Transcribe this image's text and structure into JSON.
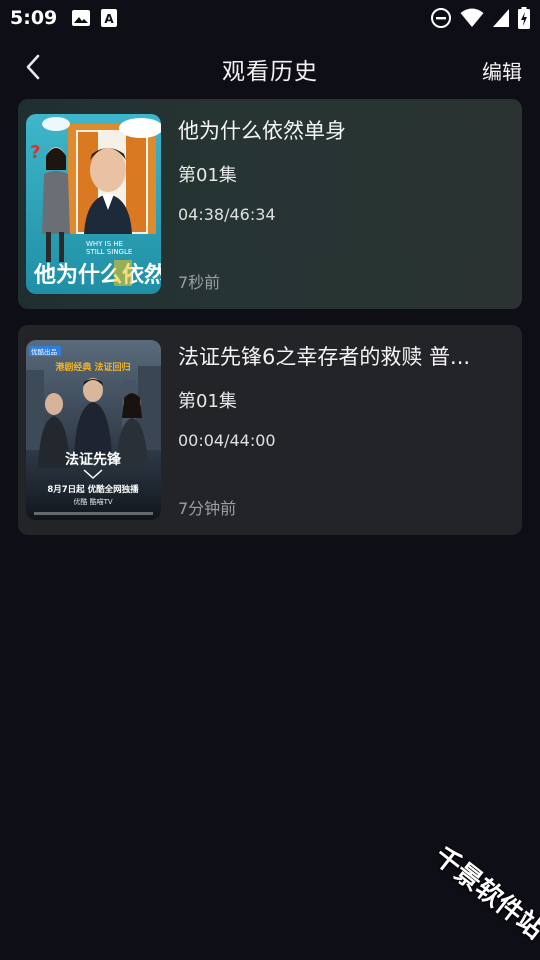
{
  "status_bar": {
    "time": "5:09",
    "left_icons": [
      "image-icon",
      "text-a-icon"
    ],
    "right_icons": [
      "do-not-disturb-icon",
      "wifi-icon",
      "signal-icon",
      "battery-charging-icon"
    ]
  },
  "header": {
    "back_icon": "chevron-left-icon",
    "title": "观看历史",
    "edit_label": "编辑"
  },
  "history": [
    {
      "title": "他为什么依然单身",
      "episode": "第01集",
      "progress": "04:38/46:34",
      "watched": "7秒前",
      "poster": {
        "title_cn": "他为什么依然单身",
        "subtitle_en": "WHY IS HE STILL SINGLE"
      }
    },
    {
      "title": "法证先锋6之幸存者的救赎 普...",
      "episode": "第01集",
      "progress": "00:04/44:00",
      "watched": "7分钟前",
      "poster": {
        "badge": "优酷出品",
        "tagline": "港剧经典 法证回归",
        "logo_text": "法证先锋",
        "release": "8月7日起 优酷全网独播",
        "platforms": "优酷  酷喵TV"
      }
    }
  ],
  "watermark": "千景软件站",
  "colors": {
    "background": "#0e0e16",
    "card_1": "#263433",
    "card_2": "#232427",
    "text_secondary": "#9a9ea3"
  }
}
